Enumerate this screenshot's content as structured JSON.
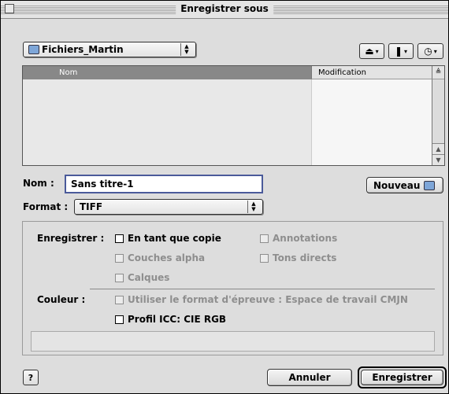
{
  "window": {
    "title": "Enregistrer sous"
  },
  "location": {
    "folder_label": "Fichiers_Martin",
    "icons": [
      "disk-icon",
      "favorites-icon",
      "recent-icon"
    ]
  },
  "file_list": {
    "columns": {
      "name": "Nom",
      "modified": "Modification"
    }
  },
  "filename": {
    "label": "Nom :",
    "value": "Sans titre-1"
  },
  "new_folder_button": {
    "label": "Nouveau"
  },
  "format": {
    "label": "Format :",
    "value": "TIFF"
  },
  "save_options": {
    "label": "Enregistrer :",
    "options": [
      {
        "label": "En tant que copie",
        "enabled": true,
        "checked": false
      },
      {
        "label": "Annotations",
        "enabled": false,
        "checked": false
      },
      {
        "label": "Couches alpha",
        "enabled": false,
        "checked": false
      },
      {
        "label": "Tons directs",
        "enabled": false,
        "checked": false
      },
      {
        "label": "Calques",
        "enabled": false,
        "checked": false
      }
    ]
  },
  "color": {
    "label": "Couleur :",
    "options": [
      {
        "label": "Utiliser le format d'épreuve : Espace de travail CMJN",
        "enabled": false,
        "checked": false
      },
      {
        "label": "Profil ICC: CIE RGB",
        "enabled": true,
        "checked": false
      }
    ]
  },
  "buttons": {
    "cancel": "Annuler",
    "save": "Enregistrer",
    "help": "?"
  }
}
